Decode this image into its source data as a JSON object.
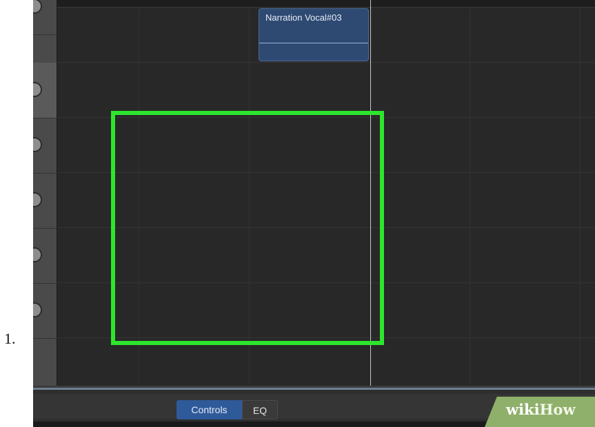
{
  "list_number": "1.",
  "timeline": {
    "region": {
      "title": "Narration Vocal#03",
      "color": "#2e4a73"
    },
    "highlight_color": "#2ee52e",
    "track_count": 6
  },
  "bottom_bar": {
    "tabs": [
      {
        "label": "Controls",
        "selected": true
      },
      {
        "label": "EQ",
        "selected": false
      }
    ]
  },
  "watermark": {
    "part1": "wiki",
    "part2": "How"
  }
}
